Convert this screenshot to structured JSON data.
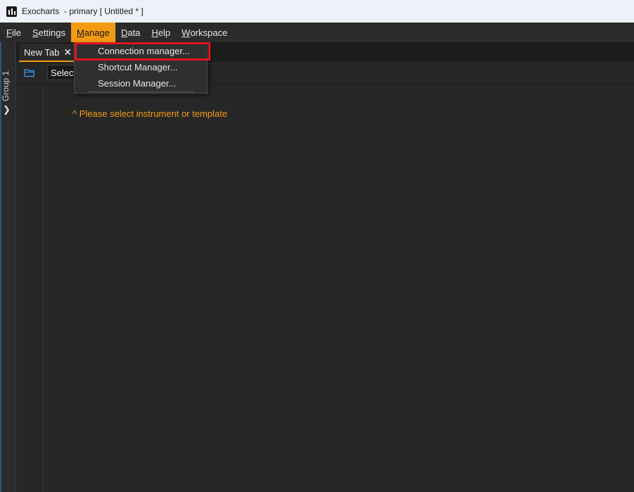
{
  "window": {
    "title": "Exocharts  - primary [ Untitled * ]"
  },
  "menubar": {
    "items": [
      {
        "mnemonic": "F",
        "rest": "ile"
      },
      {
        "mnemonic": "S",
        "rest": "ettings"
      },
      {
        "mnemonic": "M",
        "rest": "anage"
      },
      {
        "mnemonic": "D",
        "rest": "ata"
      },
      {
        "mnemonic": "H",
        "rest": "elp"
      },
      {
        "mnemonic": "W",
        "rest": "orkspace"
      }
    ],
    "active_index": 2
  },
  "manage_menu": {
    "items": [
      "Connection manager...",
      "Shortcut Manager...",
      "Session Manager..."
    ],
    "highlighted": "Connection manager..."
  },
  "sidebar": {
    "group_label": "Group 1"
  },
  "tabs": [
    {
      "label": "New Tab",
      "close": "✕"
    }
  ],
  "toolbar": {
    "selector_value": "Select instrument"
  },
  "canvas": {
    "hint": "^ Please select instrument or template"
  },
  "colors": {
    "accent": "#f39c12",
    "highlight_box": "#e0141e",
    "folder_icon": "#3a8dde"
  }
}
